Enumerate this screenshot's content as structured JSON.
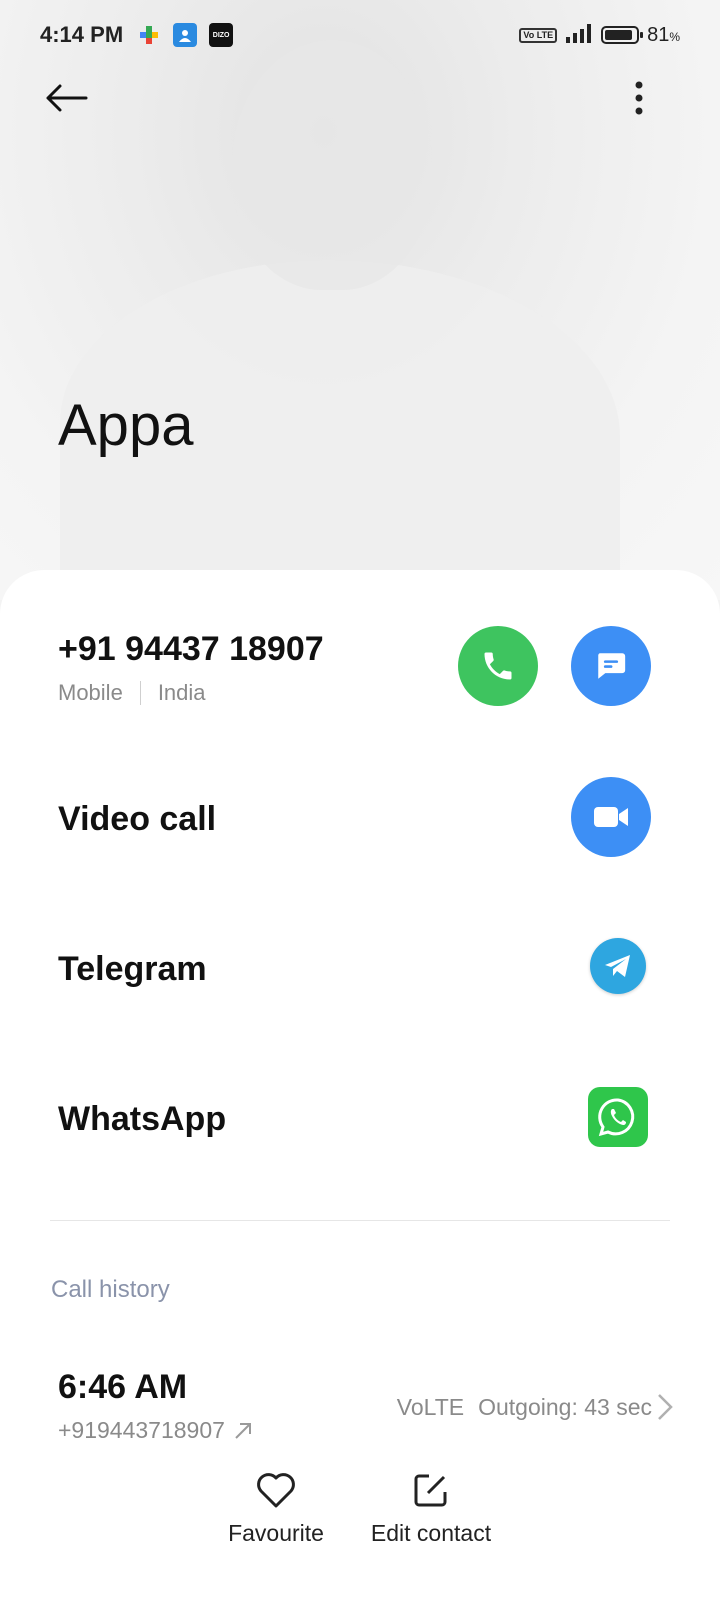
{
  "status_bar": {
    "time": "4:14 PM",
    "volte": "Vo LTE",
    "battery_value": "81",
    "battery_unit": "%",
    "notification_icons": [
      "google-games-icon",
      "contacts-icon",
      "dizo-icon"
    ],
    "dizo_label": "DIZO"
  },
  "contact": {
    "name": "Appa",
    "phone": "+91 94437 18907",
    "type": "Mobile",
    "country": "India"
  },
  "actions": {
    "video_call": "Video call",
    "telegram": "Telegram",
    "whatsapp": "WhatsApp"
  },
  "call_history": {
    "title": "Call history",
    "entries": [
      {
        "time": "6:46 AM",
        "number": "+919443718907",
        "network": "VoLTE",
        "detail": "Outgoing: 43 sec"
      }
    ]
  },
  "bottom_bar": {
    "favourite": "Favourite",
    "edit_contact": "Edit contact"
  },
  "colors": {
    "call_green": "#3ec45f",
    "action_blue": "#3d8ff5",
    "telegram_blue": "#2ea6e0",
    "whatsapp_green": "#2fc64b"
  }
}
